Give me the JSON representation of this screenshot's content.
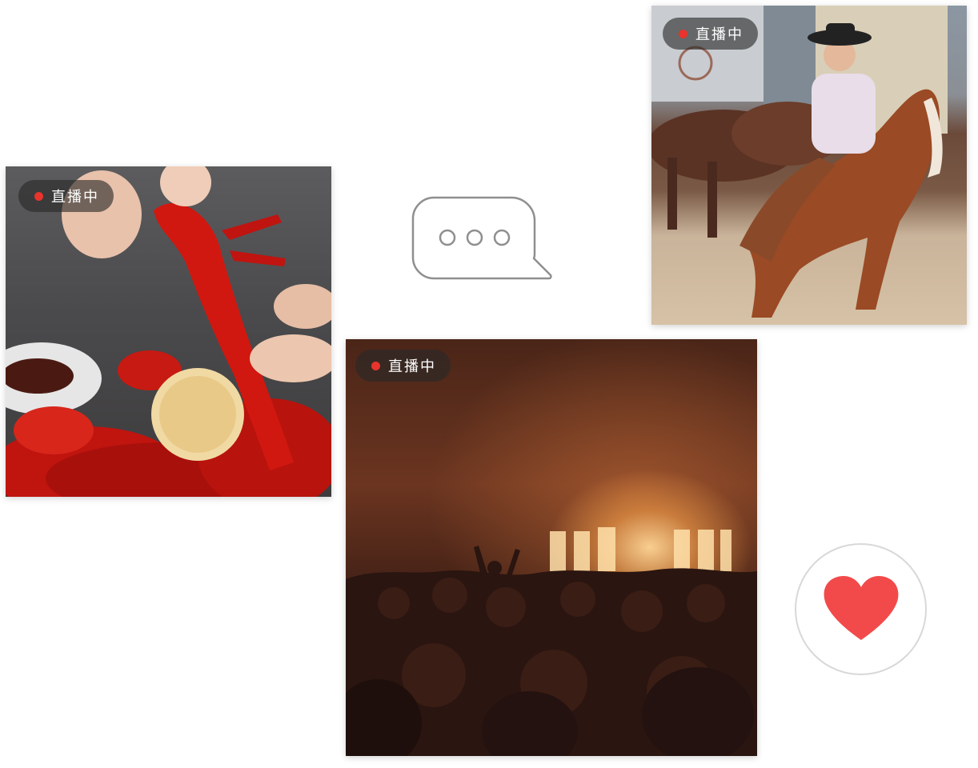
{
  "colors": {
    "live_dot": "#e8342c",
    "heart": "#f24a4a",
    "bubble_stroke": "#8f8f8f",
    "circle_border": "#d8d8d8"
  },
  "cards": [
    {
      "id": "crayfish",
      "scene": "crayfish-photo",
      "badge": {
        "label": "直播中"
      }
    },
    {
      "id": "rodeo",
      "scene": "rodeo-photo",
      "badge": {
        "label": "直播中"
      }
    },
    {
      "id": "concert",
      "scene": "concert-photo",
      "badge": {
        "label": "直播中"
      }
    }
  ],
  "icons": {
    "chat": "chat-bubble-icon",
    "like": "heart-icon"
  }
}
